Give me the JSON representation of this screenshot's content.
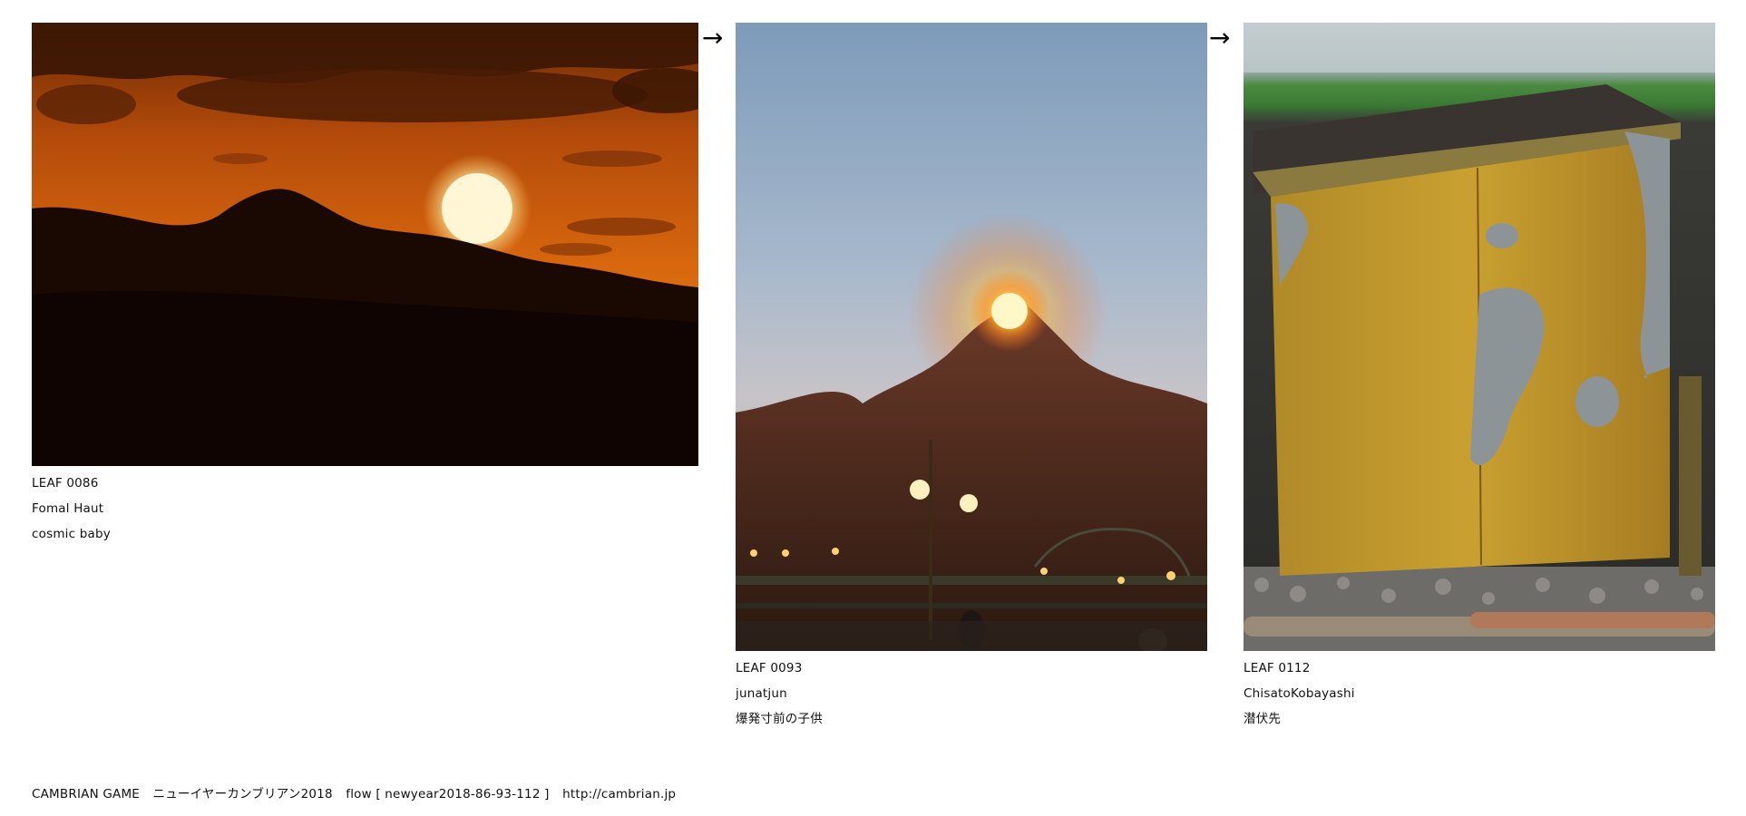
{
  "leaves": [
    {
      "id": "LEAF 0086",
      "author": "Fomal Haut",
      "title": "cosmic baby",
      "photo_subject": "sunset-over-mountains"
    },
    {
      "id": "LEAF 0093",
      "author": "junatjun",
      "title": "爆発寸前の子供",
      "photo_subject": "erupting-volcano-attraction"
    },
    {
      "id": "LEAF 0112",
      "author": "ChisatoKobayashi",
      "title": "潜伏先",
      "photo_subject": "rusty-yellow-trackside-cabinet"
    }
  ],
  "arrows": [
    "→",
    "→"
  ],
  "footer": {
    "brand": "CAMBRIAN GAME",
    "event": "ニューイヤーカンブリアン2018",
    "flow": "flow [ newyear2018-86-93-112 ]",
    "url": "http://cambrian.jp"
  },
  "colors": {
    "sky_orange": "#c85a10",
    "sun": "#fff3c4",
    "dusk_blue": "#7f9fbf",
    "cabinet_yellow": "#c9a030"
  }
}
